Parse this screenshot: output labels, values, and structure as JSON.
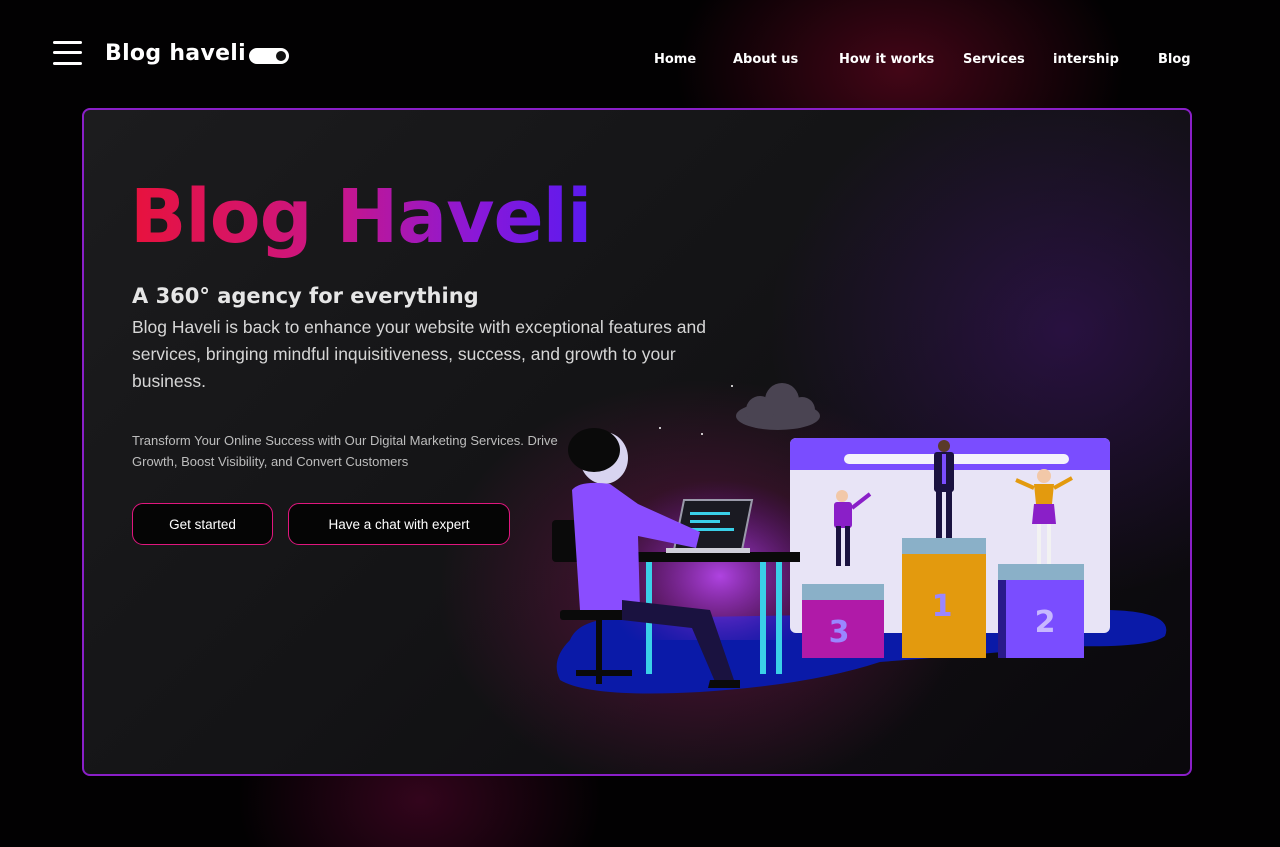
{
  "header": {
    "brand": "Blog haveli",
    "nav": [
      "Home",
      "About us",
      "How it works",
      "Services",
      "intership",
      "Blog"
    ]
  },
  "hero": {
    "title": "Blog Haveli",
    "subtitle": "A 360° agency for everything",
    "description": "Blog Haveli is back to enhance your website with exceptional features and services, bringing mindful inquisitiveness, success, and growth to your business.",
    "tagline": "Transform Your Online Success with Our Digital Marketing Services. Drive Growth, Boost Visibility, and Convert Customers",
    "buttons": {
      "primary": "Get started",
      "secondary": "Have a chat with expert"
    }
  },
  "illustration": {
    "podium": {
      "first": "1",
      "second": "2",
      "third": "3"
    }
  },
  "colors": {
    "accent_border": "#8a1fc8",
    "button_border": "#e0167e",
    "title_gradient_start": "#e8123c",
    "title_gradient_end": "#5a1af0"
  }
}
